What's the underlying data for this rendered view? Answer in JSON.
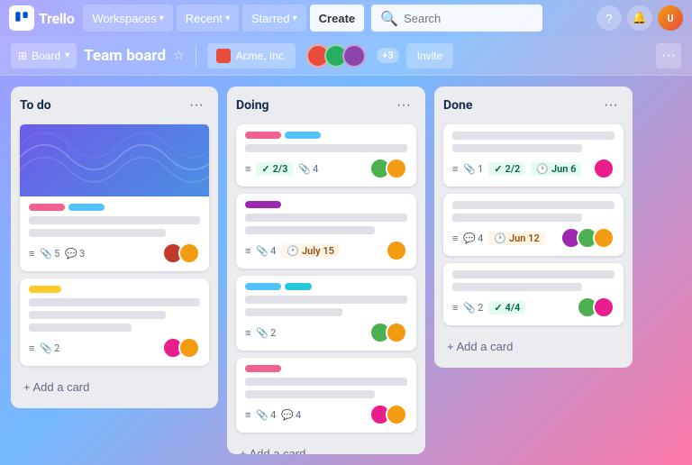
{
  "navbar": {
    "logo_letter": "T",
    "wordmark": "Trello",
    "workspaces_label": "Workspaces",
    "recent_label": "Recent",
    "starred_label": "Starred",
    "create_label": "Create",
    "search_placeholder": "Search"
  },
  "board_header": {
    "board_type": "Board",
    "board_title": "Team board",
    "workspace_name": "Acme, Inc.",
    "more_members": "+3",
    "invite_label": "Invite"
  },
  "columns": [
    {
      "id": "todo",
      "title": "To do",
      "cards": [
        {
          "has_cover": true,
          "labels": [
            "pink",
            "blue"
          ],
          "meta_icon": true,
          "attachments": 5,
          "comments": 3,
          "avatars": [
            "#c0392b",
            "#f39c12"
          ]
        },
        {
          "has_cover": false,
          "labels": [
            "yellow"
          ],
          "meta_icon": true,
          "attachments": 2,
          "comments": 0,
          "avatars": [
            "#e91e8c",
            "#f39c12"
          ]
        }
      ],
      "add_label": "+ Add a card"
    },
    {
      "id": "doing",
      "title": "Doing",
      "cards": [
        {
          "has_cover": false,
          "labels": [
            "pink",
            "blue"
          ],
          "badge_text": "2/3",
          "badge_attachments": 4,
          "avatars": [
            "#4caf50",
            "#f39c12"
          ]
        },
        {
          "has_cover": false,
          "labels": [
            "purple"
          ],
          "badge_attachments": 4,
          "due_date": "July 15",
          "avatars": [
            "#f39c12"
          ]
        },
        {
          "has_cover": false,
          "labels": [
            "blue",
            "cyan"
          ],
          "badge_attachments": 2,
          "avatars": [
            "#4caf50",
            "#f39c12"
          ]
        },
        {
          "has_cover": false,
          "labels": [
            "pink"
          ],
          "badge_attachments": 4,
          "badge_comments": 4,
          "avatars": [
            "#e91e8c",
            "#f39c12"
          ]
        }
      ],
      "add_label": "+ Add a card"
    },
    {
      "id": "done",
      "title": "Done",
      "cards": [
        {
          "has_cover": false,
          "labels": [],
          "badge_check": "2/2",
          "due_date": "Jun 6",
          "due_color": "green",
          "avatars": [
            "#e91e8c"
          ]
        },
        {
          "has_cover": false,
          "labels": [],
          "badge_comments": 4,
          "due_date": "Jun 12",
          "due_color": "orange",
          "avatars": [
            "#9c27b0",
            "#4caf50",
            "#f39c12"
          ]
        },
        {
          "has_cover": false,
          "labels": [],
          "badge_check": "4/4",
          "avatars": [
            "#4caf50",
            "#e91e8c"
          ]
        }
      ],
      "add_label": "+ Add a card"
    }
  ]
}
